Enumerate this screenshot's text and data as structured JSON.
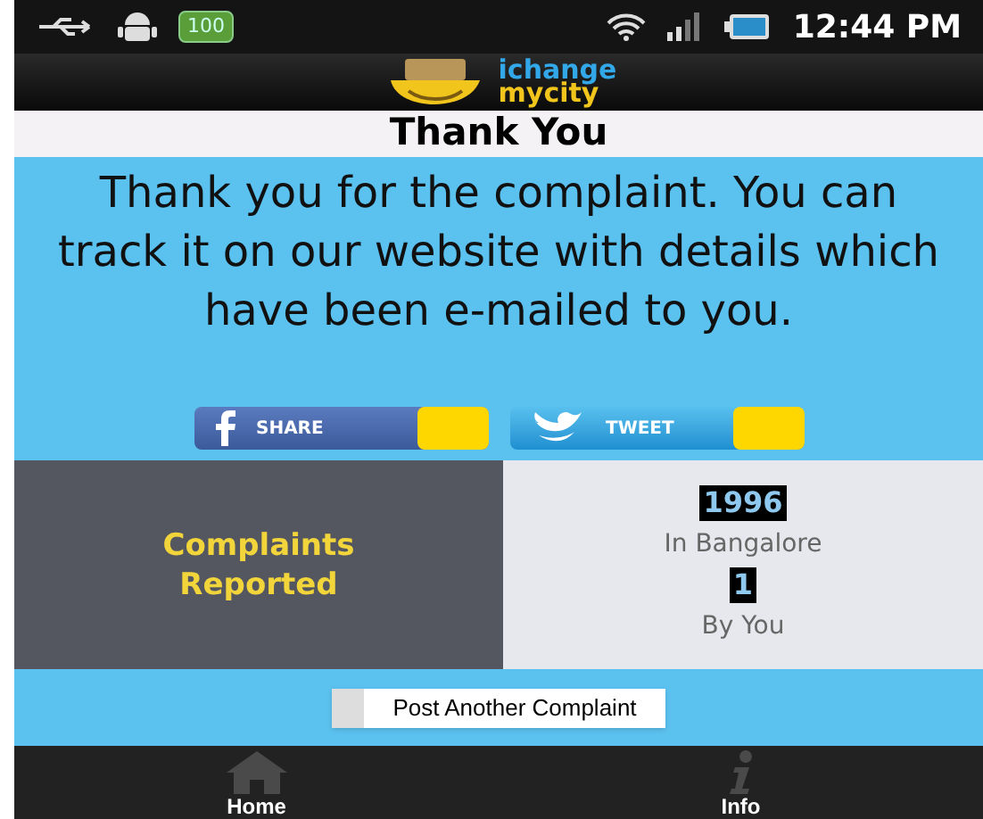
{
  "status_bar": {
    "battery_badge": "100",
    "time": "12:44 PM"
  },
  "header": {
    "logo_line_1": "ichange",
    "logo_line_2": "mycity"
  },
  "title": "Thank You",
  "message": "Thank you for the complaint. You can track it on our website with details which have been e-mailed to you.",
  "share_buttons": [
    {
      "kind": "facebook",
      "label": "SHARE"
    },
    {
      "kind": "twitter",
      "label": "TWEET"
    }
  ],
  "stats": {
    "label": "Complaints Reported",
    "rows": [
      {
        "count": "1996",
        "caption": "In Bangalore"
      },
      {
        "count": "1",
        "caption": "By You"
      }
    ]
  },
  "action_button": "Post Another Complaint",
  "nav": [
    {
      "kind": "home",
      "label": "Home"
    },
    {
      "kind": "info",
      "label": "Info"
    }
  ]
}
